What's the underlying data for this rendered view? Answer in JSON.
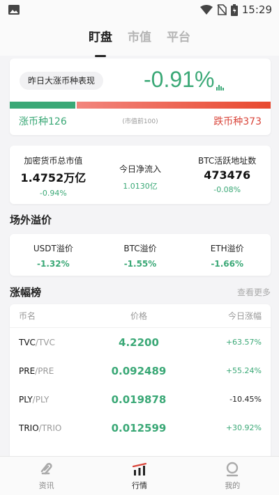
{
  "status_bar": {
    "time": "15:29",
    "icons": [
      "image-icon",
      "wifi-icon",
      "no-sim-icon",
      "battery-icon"
    ]
  },
  "top_tabs": [
    {
      "label": "盯盘",
      "active": true
    },
    {
      "label": "市值",
      "active": false
    },
    {
      "label": "平台",
      "active": false
    }
  ],
  "performance": {
    "label": "昨日大涨币种表现",
    "value": "-0.91%",
    "up_ratio": 0.252,
    "up_text": "涨币种126",
    "down_text": "跌币种373",
    "note": "(市值前100)",
    "colors": {
      "up": "#3aa876",
      "down": "#e8492f"
    }
  },
  "stats": [
    {
      "label": "加密货币总市值",
      "value": "1.4752万亿",
      "change": "-0.94%"
    },
    {
      "label": "今日净流入",
      "value": "",
      "change": "1.0130亿"
    },
    {
      "label": "BTC活跃地址数",
      "value": "473476",
      "change": "-0.08%"
    }
  ],
  "premium": {
    "title": "场外溢价",
    "items": [
      {
        "label": "USDT溢价",
        "value": "-1.32%"
      },
      {
        "label": "BTC溢价",
        "value": "-1.55%"
      },
      {
        "label": "ETH溢价",
        "value": "-1.66%"
      }
    ]
  },
  "gainers": {
    "title": "涨幅榜",
    "more": "查看更多",
    "headers": {
      "name": "币名",
      "price": "价格",
      "change": "今日涨幅"
    },
    "rows": [
      {
        "name": "TVC",
        "sym": "/TVC",
        "price": "4.2200",
        "change": "+63.57%"
      },
      {
        "name": "PRE",
        "sym": "/PRE",
        "price": "0.092489",
        "change": "+55.24%"
      },
      {
        "name": "PLY",
        "sym": "/PLY",
        "price": "0.019878",
        "change": "-10.45%"
      },
      {
        "name": "TRIO",
        "sym": "/TRIO",
        "price": "0.012599",
        "change": "+30.92%"
      }
    ]
  },
  "bottom_nav": [
    {
      "label": "资讯",
      "icon": "news-icon",
      "active": false
    },
    {
      "label": "行情",
      "icon": "market-chart-icon",
      "active": true
    },
    {
      "label": "我的",
      "icon": "profile-icon",
      "active": false
    }
  ]
}
